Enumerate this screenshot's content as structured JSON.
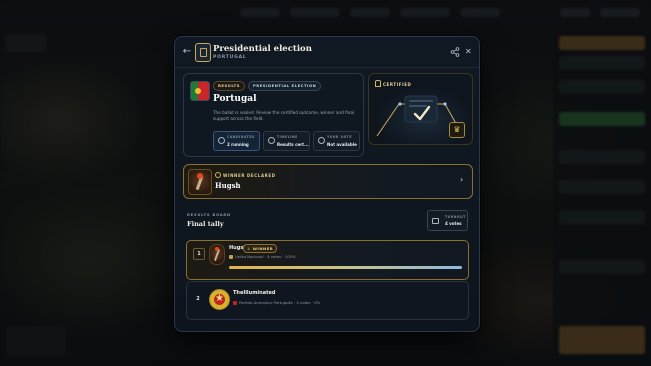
{
  "header": {
    "title": "Presidential election",
    "subtitle": "PORTUGAL"
  },
  "country_card": {
    "tags": [
      "RESULTS",
      "PRESIDENTIAL ELECTION"
    ],
    "country": "Portugal",
    "description": "The ballot is sealed. Review the certified outcome, winner and final support across the field.",
    "stats": [
      {
        "label": "CANDIDATES",
        "value": "2 running",
        "icon": "people-icon"
      },
      {
        "label": "TIMELINE",
        "value": "Results cert...",
        "icon": "clock-icon"
      },
      {
        "label": "YOUR VOTE",
        "value": "Not available",
        "icon": "ballot-icon"
      }
    ]
  },
  "certified": {
    "label": "CERTIFIED"
  },
  "winner": {
    "label": "WINNER DECLARED",
    "name": "Hugsh"
  },
  "results_board": {
    "label": "RESULTS BOARD",
    "title": "Final tally",
    "turnout_label": "TURNOUT",
    "turnout_value": "4 votes"
  },
  "candidates": [
    {
      "rank": "1",
      "name": "Hugsh",
      "badge": "WINNER",
      "party": "União Nacional",
      "votes": "4 votes",
      "percent": "100%",
      "share": 1.0
    },
    {
      "rank": "2",
      "name": "TheIlluminated",
      "party": "Partido Anárquico Português",
      "votes": "0 votes",
      "percent": "0%",
      "share": 0.0
    }
  ],
  "colors": {
    "accent_gold": "#c9a85a",
    "panel_bg": "#101923",
    "flag_green": "#1f7a3a",
    "flag_red": "#c8262a"
  }
}
